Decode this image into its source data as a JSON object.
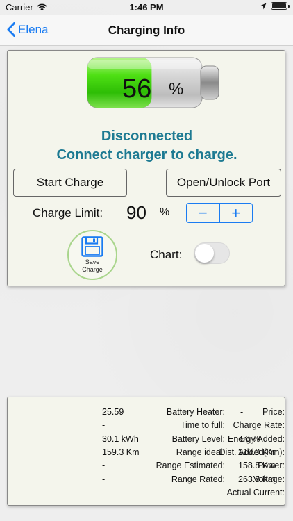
{
  "status_bar": {
    "carrier": "Carrier",
    "time": "1:46 PM"
  },
  "nav": {
    "back_label": "Elena",
    "title": "Charging Info"
  },
  "battery": {
    "percent": "56",
    "percent_sign": "%",
    "level_fraction": 0.56
  },
  "status": {
    "line1": "Disconnected",
    "line2": "Connect charger to charge."
  },
  "buttons": {
    "start_charge": "Start Charge",
    "open_port": "Open/Unlock Port"
  },
  "charge_limit": {
    "label": "Charge Limit:",
    "value": "90",
    "unit": "%",
    "minus": "−",
    "plus": "+"
  },
  "save": {
    "line1": "Save",
    "line2": "Charge"
  },
  "chart": {
    "label": "Chart:",
    "enabled": false
  },
  "info": {
    "col1": [
      "25.59",
      "-",
      "30.1 kWh",
      "159.3 Km",
      "-",
      "-",
      "-"
    ],
    "col2": [
      "Battery Heater:",
      "Time to full:",
      "Battery Level:",
      "Range ideal:",
      "Range  Estimated:",
      "Range Rated:"
    ],
    "col3": [
      "-",
      "Energy Added:",
      "Dist. Added(Km):",
      "210.9 Km",
      "158.8 Km",
      "263.8 Km"
    ],
    "col3_overlap": [
      "",
      "",
      "56 %",
      "",
      "",
      ""
    ],
    "col4": [
      "Price:",
      "Charge Rate:",
      "Energy Added:",
      "Dist. Added(Km):",
      "Power:",
      "Voltage:",
      "Actual Current:"
    ]
  },
  "colors": {
    "accent": "#1a7cf2",
    "status_text": "#1d7a92",
    "panel_bg": "#f4f5ec",
    "battery_green": "#3bd40a"
  }
}
